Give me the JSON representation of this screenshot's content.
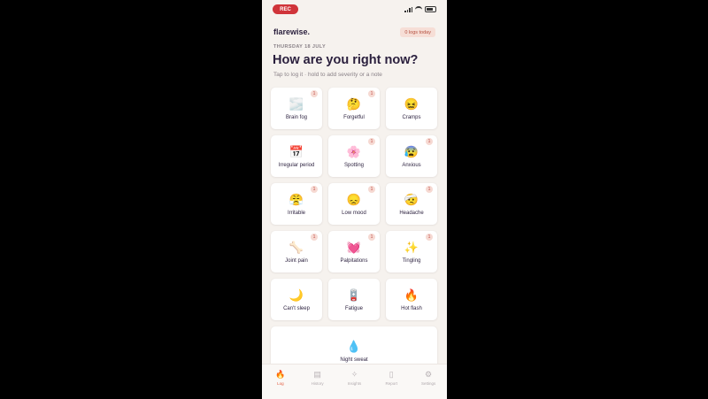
{
  "status_bar": {
    "recording_label": "REC"
  },
  "header": {
    "brand": "flarewise.",
    "logs_badge": "0 logs today",
    "date": "THURSDAY 18 JULY",
    "title": "How are you right now?",
    "subtitle": "Tap to log it · hold to add severity or a note"
  },
  "symptoms": [
    {
      "label": "Brain fog",
      "emoji": "🌫️",
      "count": "1"
    },
    {
      "label": "Forgetful",
      "emoji": "🤔",
      "count": "1"
    },
    {
      "label": "Cramps",
      "emoji": "😖",
      "count": ""
    },
    {
      "label": "Irregular period",
      "emoji": "📅",
      "count": ""
    },
    {
      "label": "Spotting",
      "emoji": "🌸",
      "count": "1"
    },
    {
      "label": "Anxious",
      "emoji": "😰",
      "count": "1"
    },
    {
      "label": "Irritable",
      "emoji": "😤",
      "count": "1"
    },
    {
      "label": "Low mood",
      "emoji": "😞",
      "count": "1"
    },
    {
      "label": "Headache",
      "emoji": "🤕",
      "count": "1"
    },
    {
      "label": "Joint pain",
      "emoji": "🦴",
      "count": "1"
    },
    {
      "label": "Palpitations",
      "emoji": "💓",
      "count": "1"
    },
    {
      "label": "Tingling",
      "emoji": "✨",
      "count": "1"
    },
    {
      "label": "Can't sleep",
      "emoji": "🌙",
      "count": ""
    },
    {
      "label": "Fatigue",
      "emoji": "🪫",
      "count": ""
    },
    {
      "label": "Hot flash",
      "emoji": "🔥",
      "count": ""
    },
    {
      "label": "Night sweat",
      "emoji": "💧",
      "count": ""
    }
  ],
  "tabs": [
    {
      "label": "Log",
      "icon": "flame-icon",
      "glyph": "🔥",
      "active": true
    },
    {
      "label": "History",
      "icon": "calendar-icon",
      "glyph": "▤",
      "active": false
    },
    {
      "label": "Insights",
      "icon": "sparkle-icon",
      "glyph": "✧",
      "active": false
    },
    {
      "label": "Report",
      "icon": "document-icon",
      "glyph": "▯",
      "active": false
    },
    {
      "label": "Settings",
      "icon": "gear-icon",
      "glyph": "⚙",
      "active": false
    }
  ],
  "colors": {
    "accent": "#e2583b",
    "background": "#f6f2ee",
    "ink": "#2a1f3d",
    "rec": "#d0343a"
  }
}
